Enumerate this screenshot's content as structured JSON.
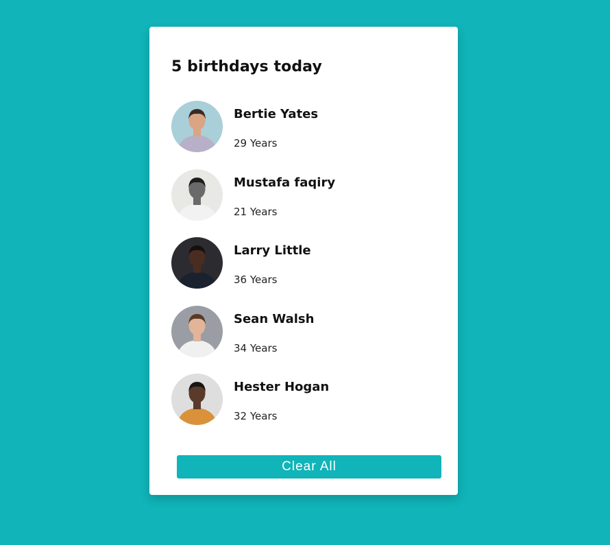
{
  "header": {
    "title": "5 birthdays today"
  },
  "people": [
    {
      "name": "Bertie Yates",
      "age": "29 Years",
      "avatar_icon": "woman-glasses-street-photo",
      "bg": "#a9cfd8",
      "skin": "#d9a585",
      "hair": "#3a2a22",
      "shirt": "#b8b0c8"
    },
    {
      "name": "Mustafa faqiry",
      "age": "21 Years",
      "avatar_icon": "man-brick-wall-bw-photo",
      "bg": "#e8e8e4",
      "skin": "#6a6a6a",
      "hair": "#1e1e1e",
      "shirt": "#f2f2f2"
    },
    {
      "name": "Larry Little",
      "age": "36 Years",
      "avatar_icon": "man-dark-shirt-photo",
      "bg": "#2c2c30",
      "skin": "#4a2c20",
      "hair": "#161010",
      "shirt": "#1a2230"
    },
    {
      "name": "Sean Walsh",
      "age": "34 Years",
      "avatar_icon": "man-glasses-beard-photo",
      "bg": "#9a9ea4",
      "skin": "#e2b49a",
      "hair": "#5a3a24",
      "shirt": "#f0f0f0"
    },
    {
      "name": "Hester Hogan",
      "age": "32 Years",
      "avatar_icon": "woman-glasses-floral-photo",
      "bg": "#dedede",
      "skin": "#5a3a2a",
      "hair": "#1a1412",
      "shirt": "#d9923a"
    }
  ],
  "actions": {
    "clear_label": "Clear All"
  },
  "colors": {
    "accent": "#10b4b9",
    "card": "#ffffff"
  }
}
